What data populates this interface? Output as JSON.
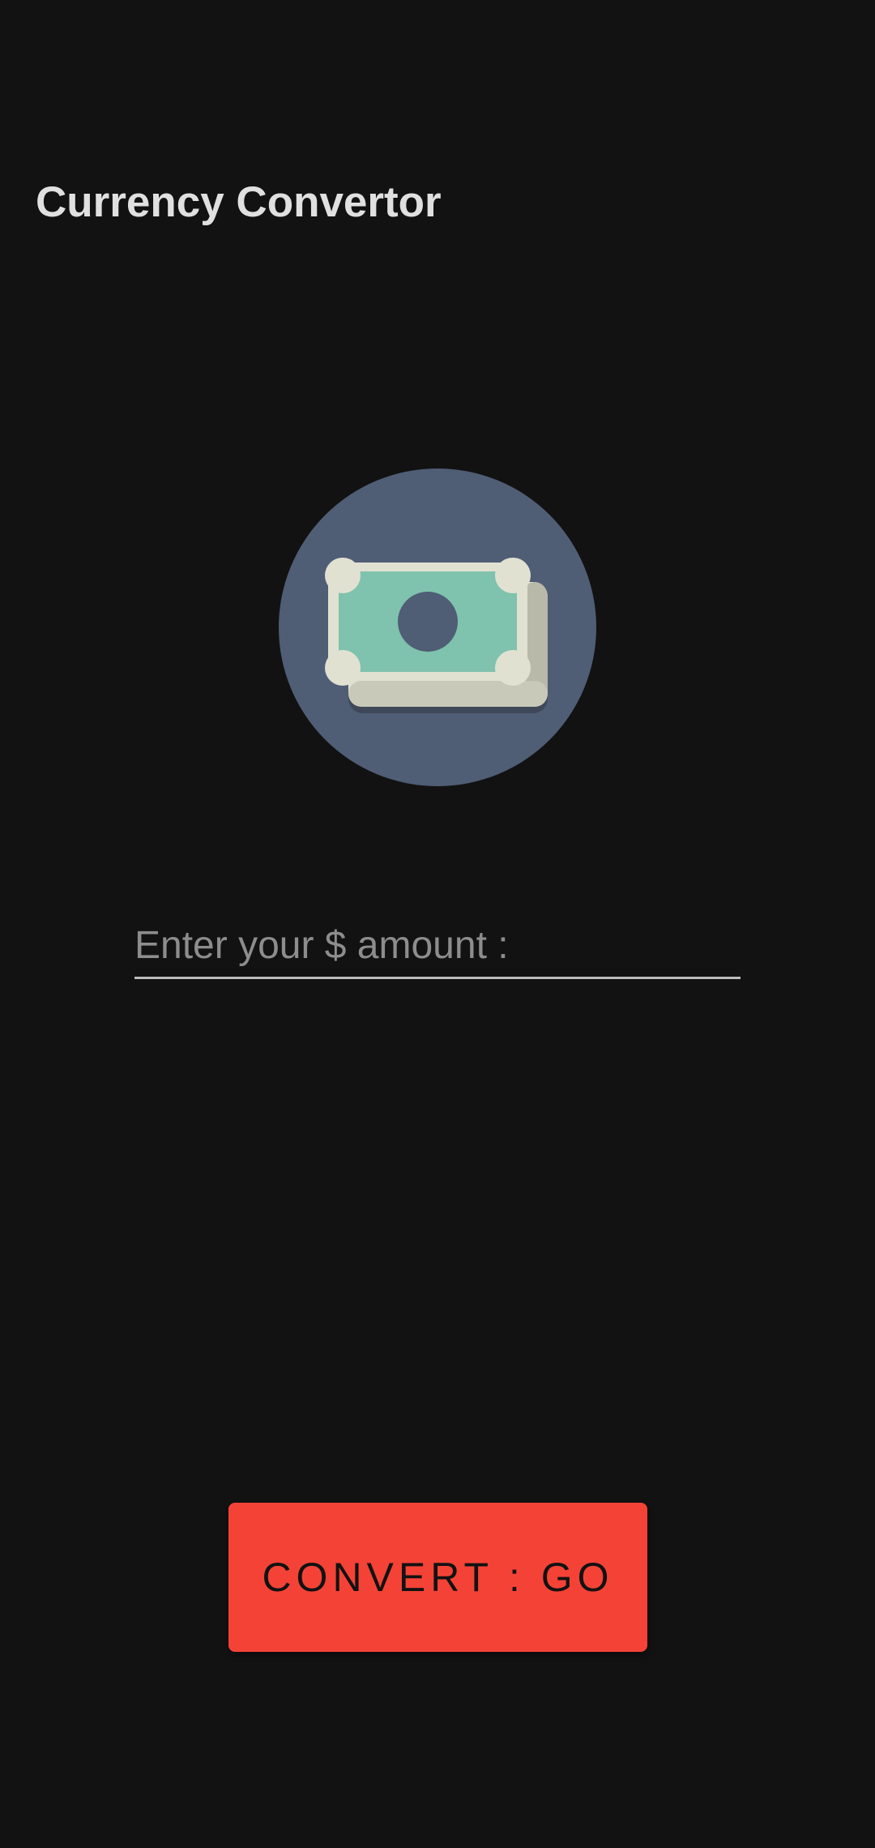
{
  "app": {
    "title": "Currency Convertor"
  },
  "logo": {
    "icon": "money-bills-icon",
    "circle_color": "#4f5d75",
    "bill_color": "#7fc2ad",
    "bill_border_color": "#e1e1d2"
  },
  "amount_input": {
    "placeholder": "Enter your $ amount :",
    "value": ""
  },
  "convert_button": {
    "label": "CONVERT : GO",
    "color": "#f44336"
  }
}
